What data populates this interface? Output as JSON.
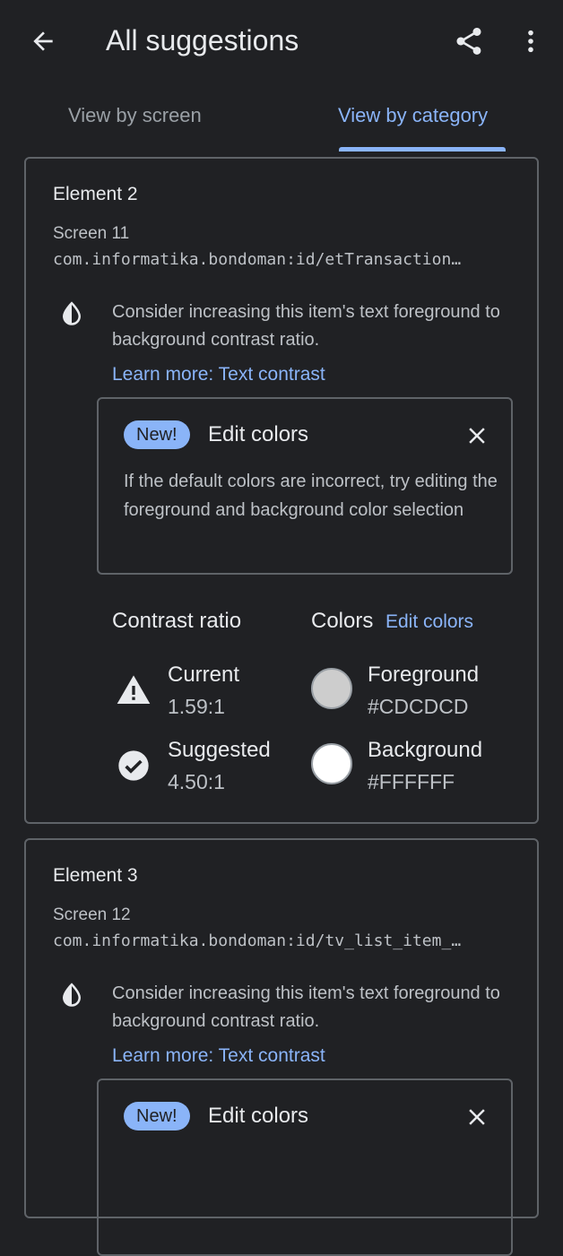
{
  "header": {
    "title": "All suggestions"
  },
  "tabs": [
    {
      "label": "View by screen",
      "selected": false
    },
    {
      "label": "View by category",
      "selected": true
    }
  ],
  "cards": [
    {
      "element": "Element 2",
      "screen": "Screen 11",
      "resource_id": "com.informatika.bondoman:id/etTransaction…",
      "message": "Consider increasing this item's text foreground to background contrast ratio.",
      "learn_more": "Learn more: Text contrast",
      "notice": {
        "badge": "New!",
        "title": "Edit colors",
        "body": "If the default colors are incorrect, try editing the foreground and background color selection"
      },
      "contrast_ratio_label": "Contrast ratio",
      "colors_label": "Colors",
      "edit_colors_link": "Edit colors",
      "current": {
        "label": "Current",
        "value": "1.59:1"
      },
      "suggested": {
        "label": "Suggested",
        "value": "4.50:1"
      },
      "foreground": {
        "label": "Foreground",
        "value": "#CDCDCD",
        "color": "#CDCDCD"
      },
      "background": {
        "label": "Background",
        "value": "#FFFFFF",
        "color": "#FFFFFF"
      }
    },
    {
      "element": "Element 3",
      "screen": "Screen 12",
      "resource_id": "com.informatika.bondoman:id/tv_list_item_…",
      "message": "Consider increasing this item's text foreground to background contrast ratio.",
      "learn_more": "Learn more: Text contrast",
      "notice": {
        "badge": "New!",
        "title": "Edit colors"
      }
    }
  ],
  "icons": {
    "back": "arrow-left",
    "share": "share",
    "more": "more-vert",
    "contrast": "contrast-drop",
    "close": "close",
    "warning": "warning-triangle",
    "check": "check-circle"
  },
  "theme": {
    "background": "#202124",
    "accent": "#8ab4f8",
    "border": "#5f6368"
  }
}
